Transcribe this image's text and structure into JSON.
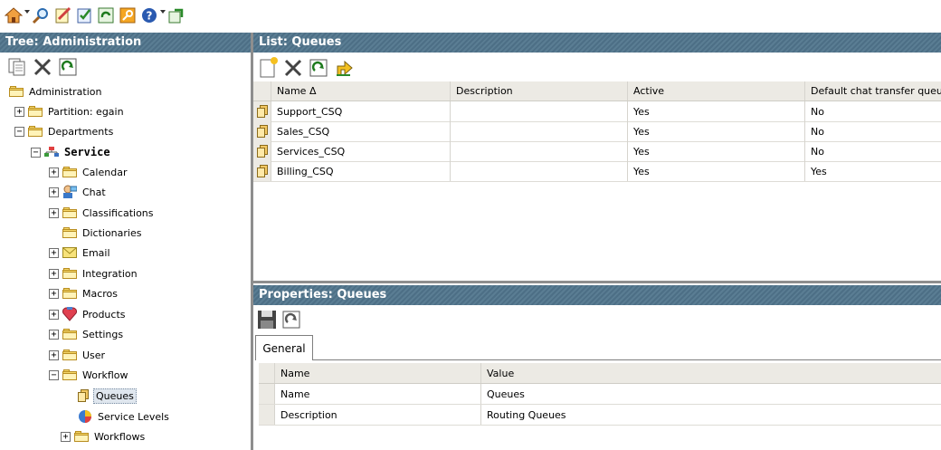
{
  "toolbar": {
    "icons": [
      "home-icon",
      "search-icon",
      "edit-icon",
      "checklist-icon",
      "refresh-icon",
      "key-icon",
      "help-icon",
      "sync-icon"
    ]
  },
  "tree": {
    "title": "Tree: Administration",
    "items": [
      {
        "label": "Administration"
      },
      {
        "label": "Partition: egain"
      },
      {
        "label": "Departments"
      },
      {
        "label": "Service"
      },
      {
        "label": "Calendar"
      },
      {
        "label": "Chat"
      },
      {
        "label": "Classifications"
      },
      {
        "label": "Dictionaries"
      },
      {
        "label": "Email"
      },
      {
        "label": "Integration"
      },
      {
        "label": "Macros"
      },
      {
        "label": "Products"
      },
      {
        "label": "Settings"
      },
      {
        "label": "User"
      },
      {
        "label": "Workflow"
      },
      {
        "label": "Queues"
      },
      {
        "label": "Service Levels"
      },
      {
        "label": "Workflows"
      }
    ]
  },
  "list": {
    "title": "List: Queues",
    "columns": [
      "Name Δ",
      "Description",
      "Active",
      "Default chat transfer queue"
    ],
    "rows": [
      {
        "name": "Support_CSQ",
        "description": "",
        "active": "Yes",
        "default_chat": "No"
      },
      {
        "name": "Sales_CSQ",
        "description": "",
        "active": "Yes",
        "default_chat": "No"
      },
      {
        "name": "Services_CSQ",
        "description": "",
        "active": "Yes",
        "default_chat": "No"
      },
      {
        "name": "Billing_CSQ",
        "description": "",
        "active": "Yes",
        "default_chat": "Yes"
      }
    ]
  },
  "properties": {
    "title": "Properties: Queues",
    "tab": "General",
    "columns": [
      "Name",
      "Value"
    ],
    "rows": [
      {
        "name": "Name",
        "value": "Queues"
      },
      {
        "name": "Description",
        "value": "Routing Queues"
      }
    ]
  },
  "colors": {
    "header_bg": "#4d6f86",
    "folder": "#f6d96b",
    "grid_header": "#eceae4"
  }
}
